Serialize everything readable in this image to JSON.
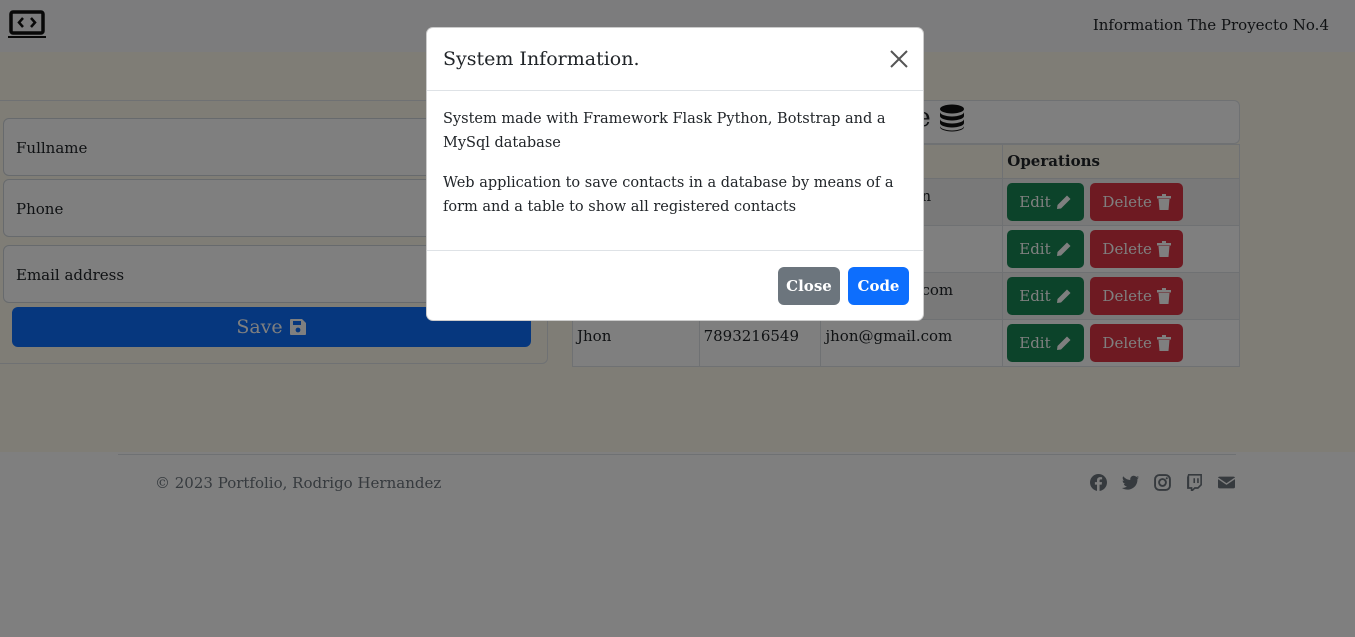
{
  "navbar": {
    "brand_icon": "laptop-code-icon",
    "title": "Information The Proyecto No.4"
  },
  "form": {
    "fullname_placeholder": "Fullname",
    "phone_placeholder": "Phone",
    "email_placeholder": "Email address",
    "save_label": "Save",
    "save_icon": "floppy-disk-icon"
  },
  "table": {
    "header_fragment": "se",
    "header_icon": "database-icon",
    "columns": [
      "Operations"
    ],
    "rows": [
      {
        "name": "",
        "phone": "",
        "email": "n"
      },
      {
        "name": "",
        "phone": "",
        "email": ""
      },
      {
        "name": "",
        "phone": "",
        "email": "com"
      },
      {
        "name": "Jhon",
        "phone": "7893216549",
        "email": "jhon@gmail.com"
      }
    ],
    "edit_label": "Edit",
    "delete_label": "Delete"
  },
  "footer": {
    "copyright": "© 2023 Portfolio, Rodrigo Hernandez",
    "social_icons": [
      "facebook-icon",
      "twitter-icon",
      "instagram-icon",
      "twitch-icon",
      "envelope-icon"
    ]
  },
  "modal": {
    "title": "System Information.",
    "body_p1": "System made with Framework Flask Python, Botstrap and a MySql database",
    "body_p2": "Web application to save contacts in a database by means of a form and a table to show all registered contacts",
    "close_label": "Close",
    "code_label": "Code"
  },
  "colors": {
    "primary": "#0d6efd",
    "success": "#198754",
    "danger": "#dc3545",
    "secondary": "#6c757d"
  }
}
